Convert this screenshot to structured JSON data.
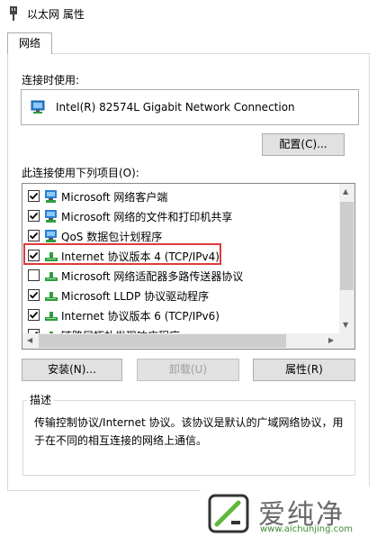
{
  "window": {
    "title": "以太网 属性"
  },
  "tabs": [
    {
      "label": "网络"
    }
  ],
  "connect_using": {
    "label": "连接时使用:",
    "adapter": "Intel(R) 82574L Gigabit Network Connection",
    "configure_button": "配置(C)..."
  },
  "items_section": {
    "label": "此连接使用下列项目(O):",
    "items": [
      {
        "label": "Microsoft 网络客户端",
        "checked": true,
        "icon": "network-client-icon"
      },
      {
        "label": "Microsoft 网络的文件和打印机共享",
        "checked": true,
        "icon": "file-printer-sharing-icon"
      },
      {
        "label": "QoS 数据包计划程序",
        "checked": true,
        "icon": "qos-icon"
      },
      {
        "label": "Internet 协议版本 4 (TCP/IPv4)",
        "checked": true,
        "icon": "protocol-icon"
      },
      {
        "label": "Microsoft 网络适配器多路传送器协议",
        "checked": false,
        "icon": "protocol-icon"
      },
      {
        "label": "Microsoft LLDP 协议驱动程序",
        "checked": true,
        "icon": "protocol-icon"
      },
      {
        "label": "Internet 协议版本 6 (TCP/IPv6)",
        "checked": true,
        "icon": "protocol-icon"
      },
      {
        "label": "链路层拓扑发现响应程序",
        "checked": true,
        "icon": "protocol-icon"
      }
    ]
  },
  "buttons": {
    "install": "安装(N)...",
    "uninstall": "卸载(U)",
    "properties": "属性(R)"
  },
  "description": {
    "title": "描述",
    "text": "传输控制协议/Internet 协议。该协议是默认的广域网络协议，用于在不同的相互连接的网络上通信。"
  },
  "watermark": {
    "brand": "爱纯净",
    "url": "www.aichunjing.com"
  },
  "colors": {
    "highlight_border": "#e03a3a",
    "focus_border": "#0078d7",
    "protocol_icon_green": "#2e9e3c",
    "monitor_blue": "#2a7fd4"
  }
}
